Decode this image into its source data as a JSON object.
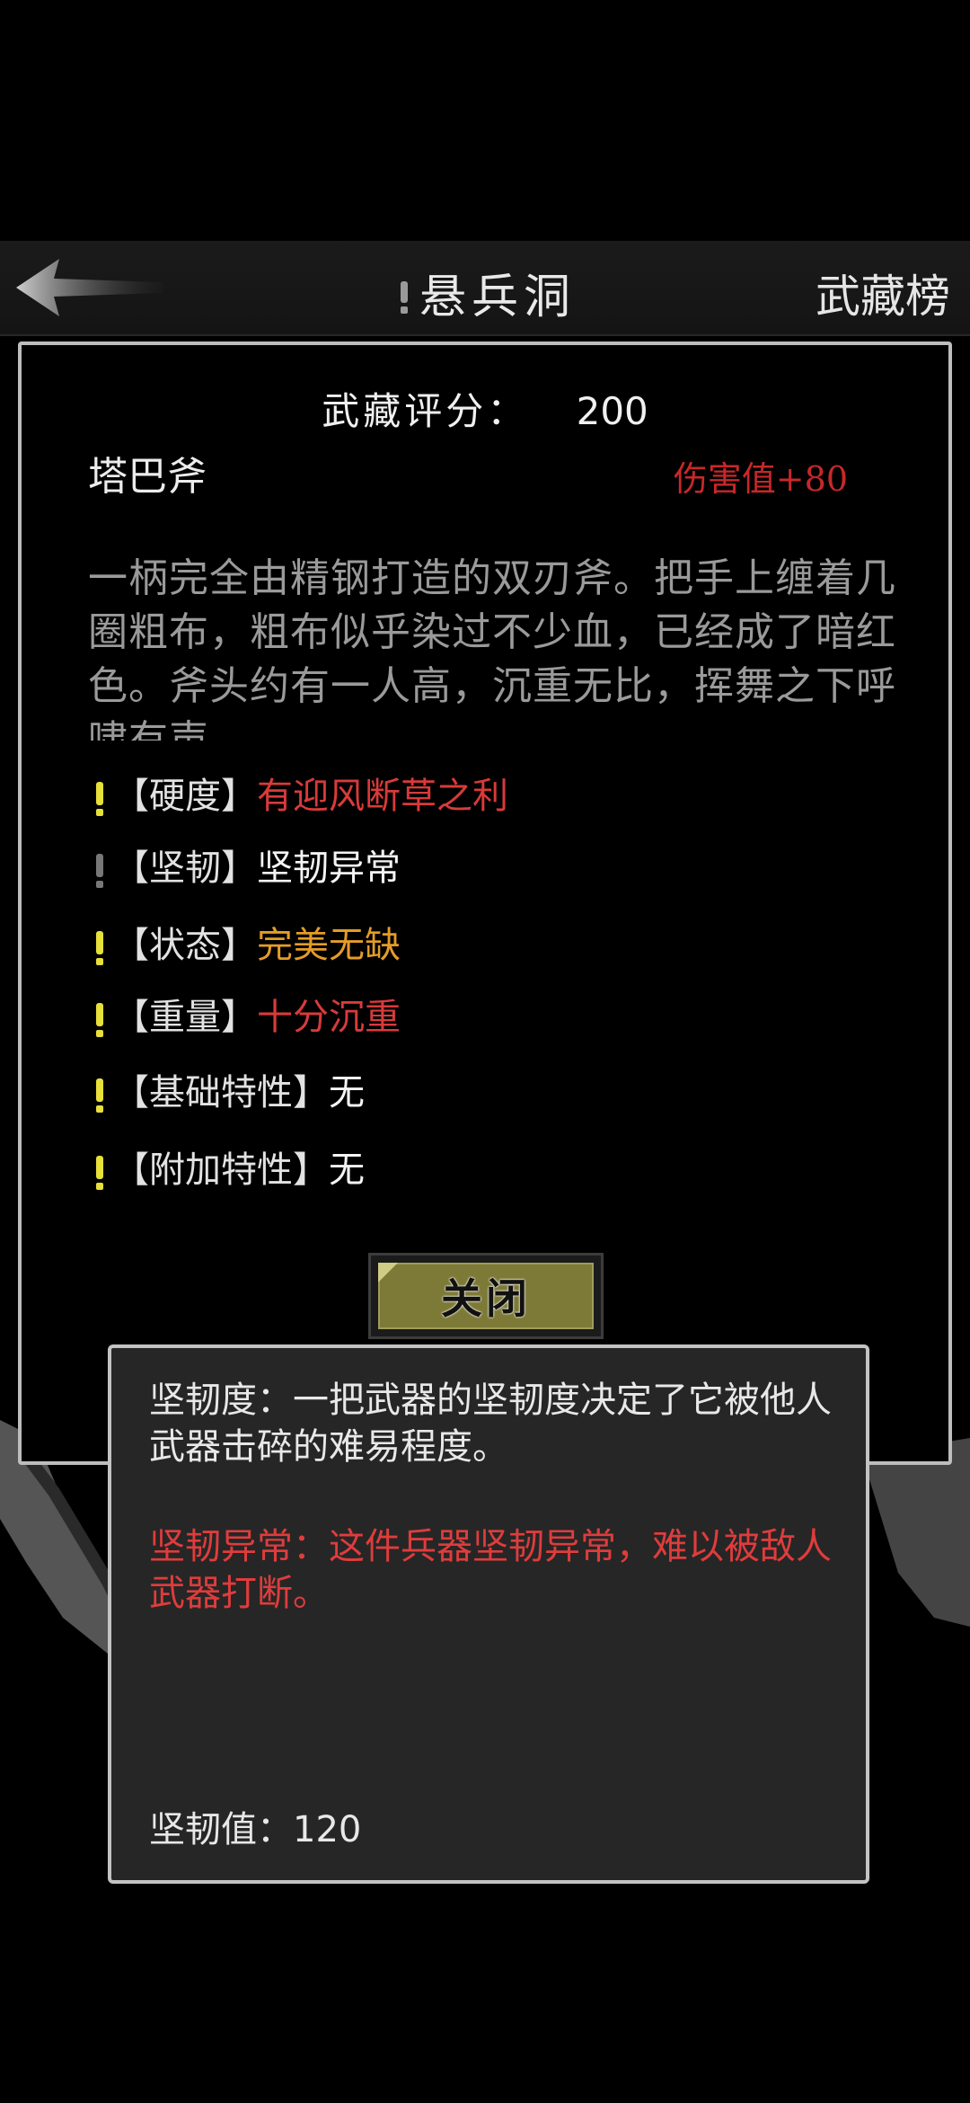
{
  "nav": {
    "title": "悬兵洞",
    "right_label": "武藏榜",
    "back_icon": "back-arrow-icon"
  },
  "item": {
    "score_label": "武藏评分：",
    "score_value": "200",
    "name": "塔巴斧",
    "damage": "伤害值+80",
    "description": "一柄完全由精钢打造的双刃斧。把手上缠着几圈粗布，粗布似乎染过不少血，已经成了暗红色。斧头约有一人高，沉重无比，挥舞之下呼啸有声"
  },
  "attributes": [
    {
      "label": "【硬度】",
      "value": "有迎风断草之利",
      "color": "#d93a3a"
    },
    {
      "label": "【坚韧】",
      "value": "坚韧异常",
      "color": "#f4f4f4"
    },
    {
      "label": "【状态】",
      "value": "完美无缺",
      "color": "#e49c28"
    },
    {
      "label": "【重量】",
      "value": "十分沉重",
      "color": "#d93a3a"
    },
    {
      "label": "【基础特性】",
      "value": "无",
      "color": "#f4f4f4"
    },
    {
      "label": "【附加特性】",
      "value": "无",
      "color": "#f4f4f4"
    }
  ],
  "close_button": {
    "label": "关闭"
  },
  "tooltip": {
    "definition": "坚韧度：一把武器的坚韧度决定了它被他人武器击碎的难易程度。",
    "detail": "坚韧异常：这件兵器坚韧异常，难以被敌人武器打断。",
    "value": "坚韧值：120"
  }
}
